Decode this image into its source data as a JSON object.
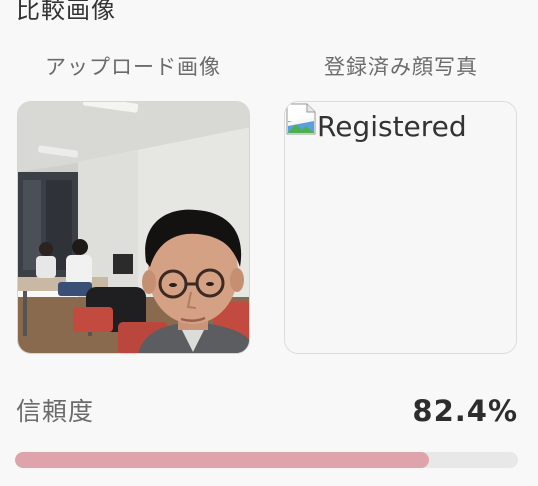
{
  "section": {
    "title": "比較画像"
  },
  "columns": {
    "upload_label": "アップロード画像",
    "registered_label": "登録済み顔写真"
  },
  "registered_image": {
    "alt_text": "Registered",
    "icon": "broken-image-icon"
  },
  "upload_image": {
    "description_icon": "photo"
  },
  "confidence": {
    "label": "信頼度",
    "value_text": "82.4%",
    "value": 82.4,
    "bar_color": "#dea3ab",
    "track_color": "#e8e8e8"
  }
}
